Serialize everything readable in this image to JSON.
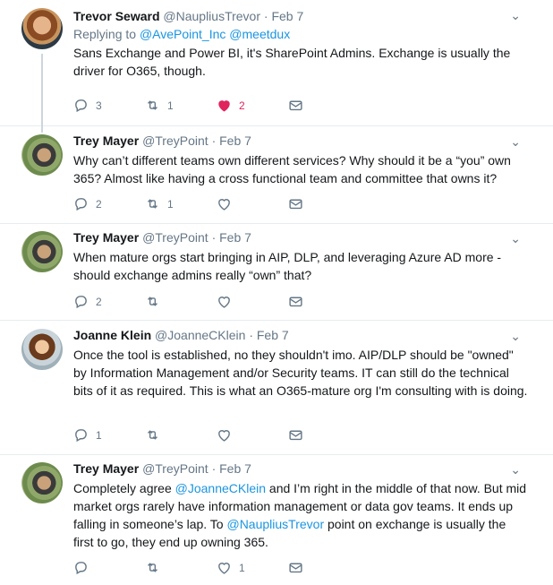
{
  "tweets": [
    {
      "name": "Trevor Seward",
      "handle": "@NaupliusTrevor",
      "date": "Feb 7",
      "replying_label": "Replying to",
      "replying_to": [
        "@AvePoint_Inc",
        "@meetdux"
      ],
      "text": "Sans Exchange and Power BI, it's SharePoint Admins. Exchange is usually the driver for O365, though.",
      "reply_count": "3",
      "retweet_count": "1",
      "like_count": "2",
      "liked": true
    },
    {
      "name": "Trey Mayer",
      "handle": "@TreyPoint",
      "date": "Feb 7",
      "text": "Why can’t different teams own different services? Why should it be a “you” own 365? Almost like having a cross functional team and committee that owns it?",
      "reply_count": "2",
      "retweet_count": "1",
      "like_count": "",
      "liked": false
    },
    {
      "name": "Trey Mayer",
      "handle": "@TreyPoint",
      "date": "Feb 7",
      "text": "When mature orgs start bringing in AIP, DLP, and leveraging Azure AD more - should exchange admins really “own” that?",
      "reply_count": "2",
      "retweet_count": "",
      "like_count": "",
      "liked": false
    },
    {
      "name": "Joanne Klein",
      "handle": "@JoanneCKlein",
      "date": "Feb 7",
      "text": "Once the tool is established, no they shouldn't imo. AIP/DLP should be \"owned\" by Information Management and/or Security teams. IT can still do the technical bits of it as required. This is what an O365-mature org I'm consulting with is doing.",
      "reply_count": "1",
      "retweet_count": "",
      "like_count": "",
      "liked": false
    },
    {
      "name": "Trey Mayer",
      "handle": "@TreyPoint",
      "date": "Feb 7",
      "text_parts": [
        "Completely agree ",
        "@JoanneCKlein",
        " and I’m right in the middle of that now. But mid market orgs rarely have information management or data gov teams. It ends up falling in someone’s lap. To ",
        "@NaupliusTrevor",
        " point on exchange is usually the first to go, they end up owning 365."
      ],
      "reply_count": "",
      "retweet_count": "",
      "like_count": "1",
      "liked": false
    }
  ],
  "icons": {
    "reply": "reply-icon",
    "retweet": "retweet-icon",
    "like": "heart-icon",
    "dm": "envelope-icon",
    "caret": "chevron-down-icon"
  },
  "colors": {
    "mention": "#1b95e0",
    "liked": "#e0245e",
    "muted": "#657786"
  }
}
